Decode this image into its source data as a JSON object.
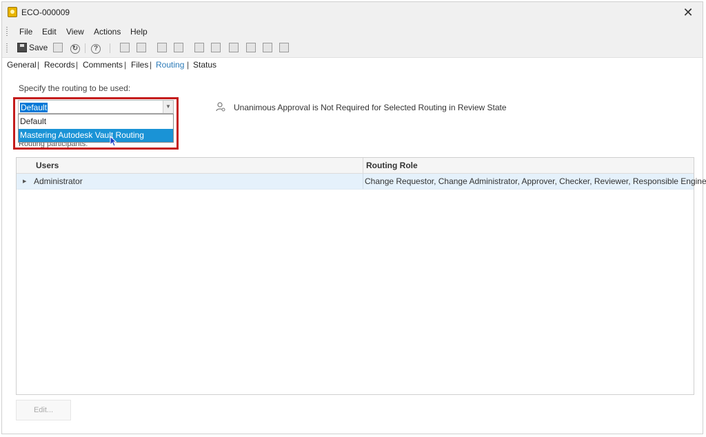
{
  "window": {
    "title": "ECO-000009",
    "close_glyph": "✕",
    "title_icon": "eco-icon"
  },
  "menu": {
    "items": [
      "File",
      "Edit",
      "View",
      "Actions",
      "Help"
    ]
  },
  "toolbar": {
    "save_label": "Save",
    "icons": [
      "save-icon",
      "properties-icon",
      "refresh-icon",
      "help-icon",
      "add-record-icon",
      "remove-record-icon",
      "move-up-icon",
      "move-down-icon",
      "add-file-icon",
      "attach-icon",
      "markup-icon",
      "approve-icon",
      "reject-icon",
      "report-icon"
    ]
  },
  "tabs": [
    {
      "label": "General",
      "active": false
    },
    {
      "label": "Records",
      "active": false
    },
    {
      "label": "Comments",
      "active": false
    },
    {
      "label": "Files",
      "active": false
    },
    {
      "label": "Routing",
      "active": true
    },
    {
      "label": "Status",
      "active": false
    }
  ],
  "routing": {
    "prompt": "Specify the routing to be used:",
    "selected": "Default",
    "options": [
      "Default",
      "Mastering Autodesk Vault Routing"
    ],
    "highlighted_option": "Mastering Autodesk Vault Routing",
    "approval_note": "Unanimous Approval is Not Required for Selected Routing in Review State",
    "participants_label": "Routing participants:"
  },
  "grid": {
    "columns": [
      "Users",
      "Routing Role"
    ],
    "rows": [
      {
        "user": "Administrator",
        "role": "Change Requestor, Change Administrator, Approver, Checker, Reviewer, Responsible Enginee..."
      }
    ]
  },
  "actions": {
    "edit_label": "Edit..."
  },
  "colors": {
    "accent": "#1a93d6",
    "highlight_border": "#c41b1b",
    "row_selected": "#e5f1fb"
  }
}
